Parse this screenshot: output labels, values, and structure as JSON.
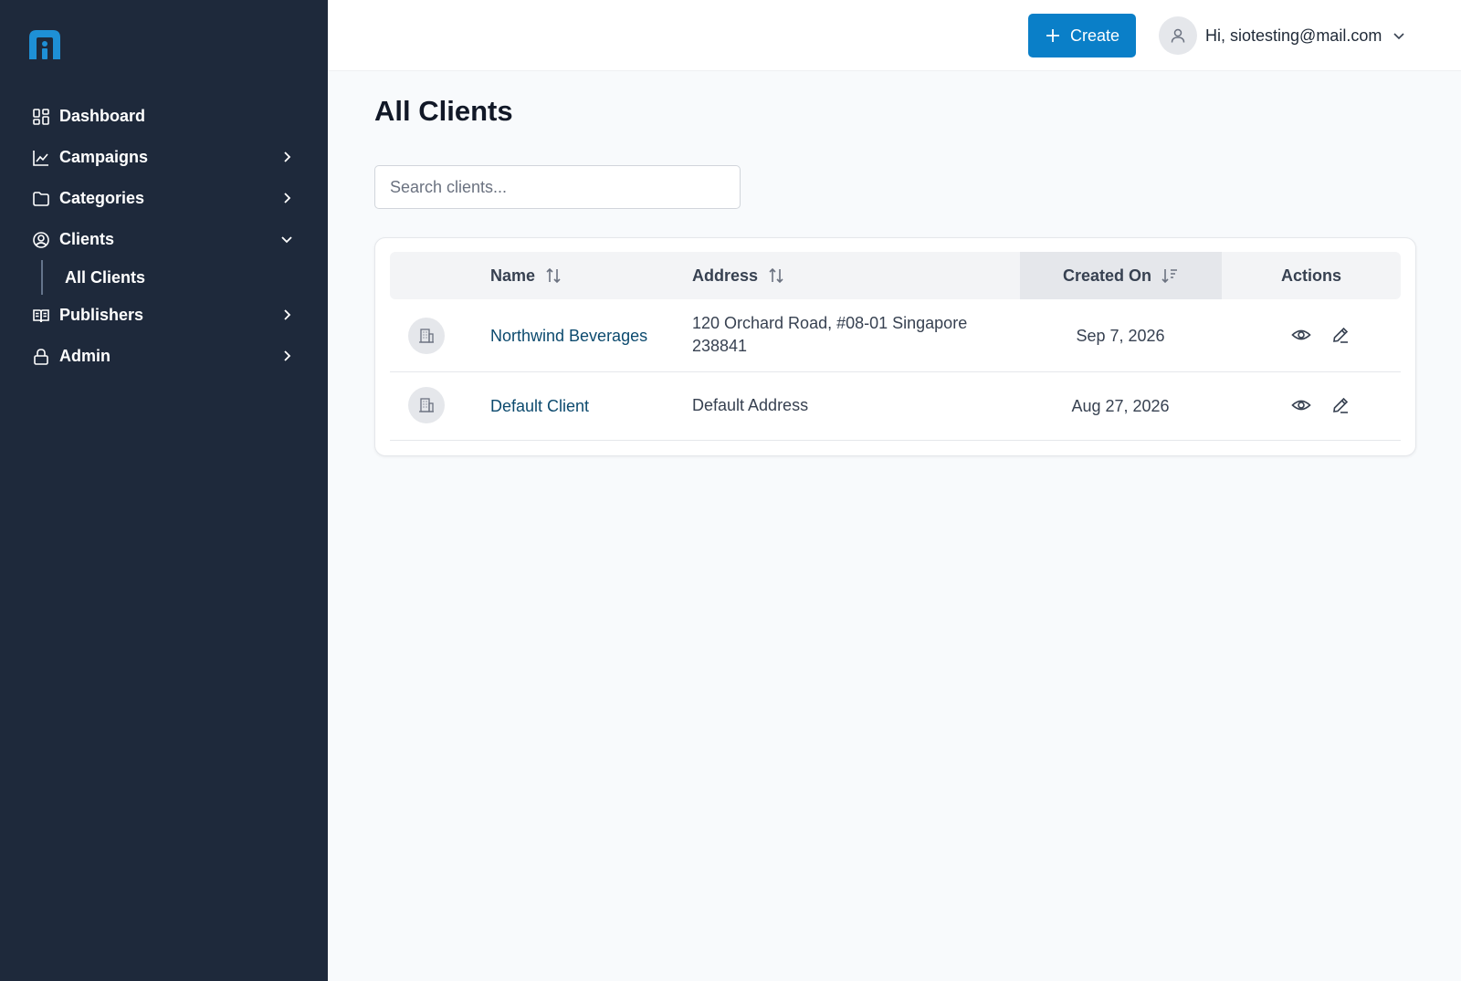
{
  "sidebar": {
    "logo": "brand-logo",
    "items": [
      {
        "label": "Dashboard",
        "icon": "dashboard-icon",
        "chevron": "none"
      },
      {
        "label": "Campaigns",
        "icon": "chart-line-icon",
        "chevron": "right"
      },
      {
        "label": "Categories",
        "icon": "folder-icon",
        "chevron": "right"
      },
      {
        "label": "Clients",
        "icon": "user-circle-icon",
        "chevron": "down",
        "children": [
          {
            "label": "All Clients"
          }
        ]
      },
      {
        "label": "Publishers",
        "icon": "book-open-icon",
        "chevron": "right"
      },
      {
        "label": "Admin",
        "icon": "lock-icon",
        "chevron": "right"
      }
    ]
  },
  "header": {
    "create_label": "Create",
    "user_greeting": "Hi, siotesting@mail.com"
  },
  "page": {
    "title": "All Clients",
    "search_placeholder": "Search clients..."
  },
  "table": {
    "columns": [
      "Name",
      "Address",
      "Created On",
      "Actions"
    ],
    "sorted_column": "Created On",
    "rows": [
      {
        "name": "Northwind Beverages",
        "address_line1": "120 Orchard Road, #08-01 Singapore",
        "address_line2": "238841",
        "created_on": "Sep 7, 2026"
      },
      {
        "name": "Default Client",
        "address_line1": "Default Address",
        "address_line2": "",
        "created_on": "Aug 27, 2026"
      }
    ]
  },
  "colors": {
    "sidebar_bg": "#1e293b",
    "accent": "#0a7fc8",
    "link": "#0c4a6e"
  }
}
